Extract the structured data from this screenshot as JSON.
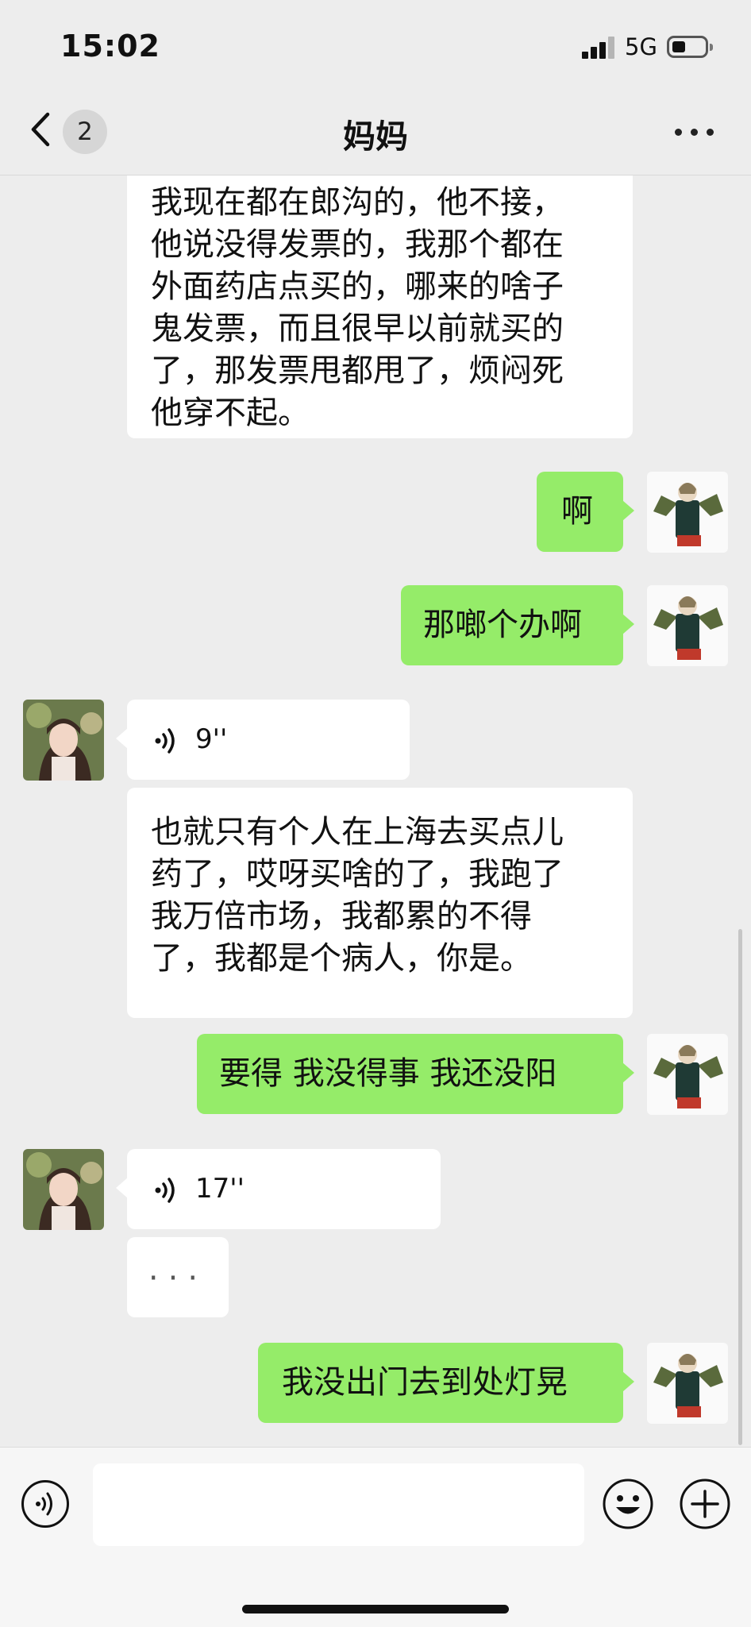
{
  "status_bar": {
    "time": "15:02",
    "network": "5G",
    "battery_level": 0.35
  },
  "header": {
    "back_badge": "2",
    "title": "妈妈",
    "more_icon": "more-dots-icon"
  },
  "messages": [
    {
      "side": "in",
      "type": "text",
      "text": "我现在都在郎沟的，他不接，\n他说没得发票的，我那个都在\n外面药店点买的，哪来的啥子\n鬼发票，而且很早以前就买的\n了，那发票甩都甩了，烦闷死\n他穿不起。"
    },
    {
      "side": "out",
      "type": "text",
      "text": "啊"
    },
    {
      "side": "out",
      "type": "text",
      "text": "那啷个办啊"
    },
    {
      "side": "in",
      "type": "voice",
      "duration": "9''"
    },
    {
      "side": "in",
      "type": "text",
      "text": "也就只有个人在上海去买点儿\n药了，哎呀买啥的了，我跑了\n我万倍市场，我都累的不得\n了，我都是个病人，你是。"
    },
    {
      "side": "out",
      "type": "text",
      "text": "要得 我没得事 我还没阳"
    },
    {
      "side": "in",
      "type": "voice",
      "duration": "17''"
    },
    {
      "side": "in",
      "type": "typing",
      "text": "···"
    },
    {
      "side": "out",
      "type": "text",
      "text": "我没出门去到处灯晃"
    }
  ],
  "input_bar": {
    "voice_icon": "voice-toggle-icon",
    "placeholder": "",
    "emoji_icon": "emoji-icon",
    "plus_icon": "plus-icon"
  },
  "colors": {
    "background": "#ededed",
    "outgoing_bubble": "#95ec69",
    "incoming_bubble": "#ffffff"
  }
}
